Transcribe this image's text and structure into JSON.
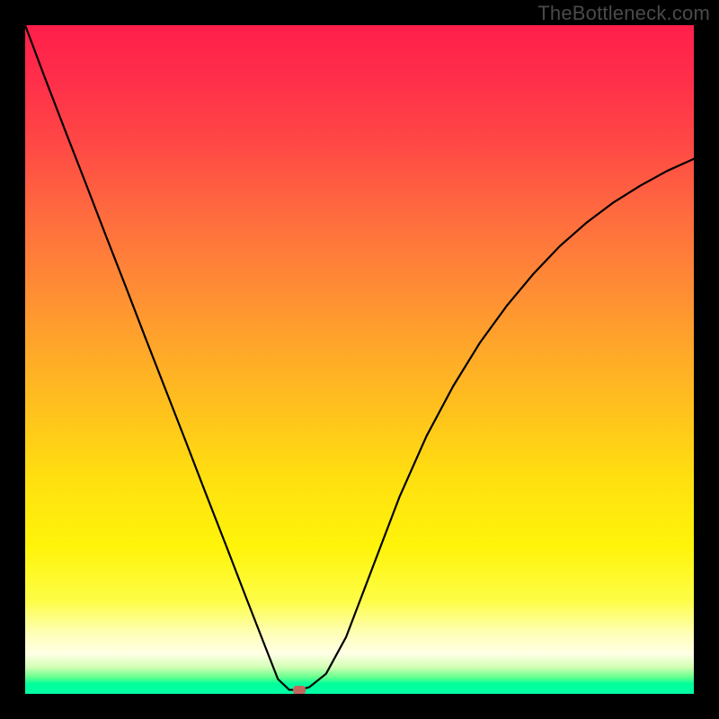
{
  "watermark": "TheBottleneck.com",
  "colors": {
    "page_bg": "#000000",
    "curve_stroke": "#000000",
    "marker_fill": "#c4665f",
    "watermark_text": "#4a4a4a"
  },
  "chart_data": {
    "type": "line",
    "title": "",
    "xlabel": "",
    "ylabel": "",
    "xlim": [
      0,
      1
    ],
    "ylim": [
      0,
      1
    ],
    "grid": false,
    "legend": false,
    "series": [
      {
        "name": "curve",
        "x": [
          0.0,
          0.03,
          0.06,
          0.09,
          0.12,
          0.15,
          0.18,
          0.21,
          0.24,
          0.27,
          0.3,
          0.33,
          0.36,
          0.378,
          0.395,
          0.41,
          0.425,
          0.45,
          0.48,
          0.52,
          0.56,
          0.6,
          0.64,
          0.68,
          0.72,
          0.76,
          0.8,
          0.84,
          0.88,
          0.92,
          0.96,
          1.0
        ],
        "y": [
          1.0,
          0.92,
          0.842,
          0.765,
          0.687,
          0.61,
          0.532,
          0.455,
          0.378,
          0.3,
          0.223,
          0.145,
          0.068,
          0.022,
          0.006,
          0.006,
          0.01,
          0.03,
          0.085,
          0.19,
          0.295,
          0.385,
          0.46,
          0.525,
          0.58,
          0.628,
          0.67,
          0.705,
          0.735,
          0.76,
          0.782,
          0.8
        ]
      }
    ],
    "marker": {
      "x": 0.41,
      "y": 0.006
    }
  }
}
